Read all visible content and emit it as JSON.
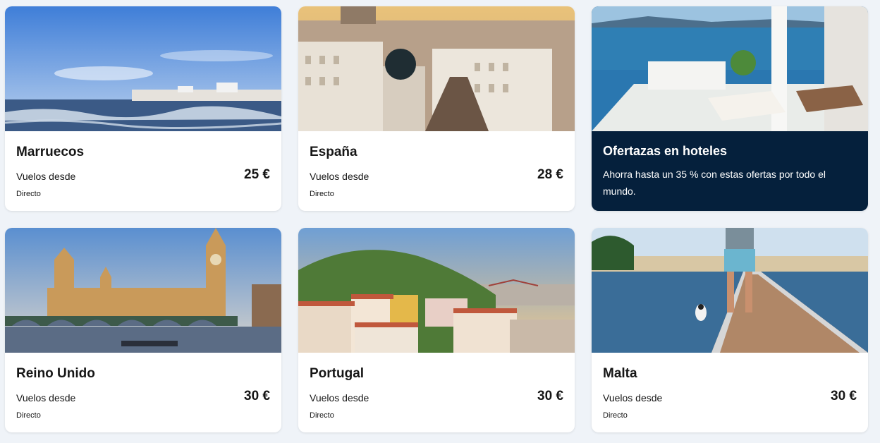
{
  "cards": [
    {
      "title": "Marruecos",
      "label": "Vuelos desde",
      "price": "25 €",
      "sub": "Directo"
    },
    {
      "title": "España",
      "label": "Vuelos desde",
      "price": "28 €",
      "sub": "Directo"
    },
    {
      "title": "Ofertazas en hoteles",
      "description": "Ahorra hasta un 35 % con estas ofertas por todo el mundo.",
      "background": "#05203c"
    },
    {
      "title": "Reino Unido",
      "label": "Vuelos desde",
      "price": "30 €",
      "sub": "Directo"
    },
    {
      "title": "Portugal",
      "label": "Vuelos desde",
      "price": "30 €",
      "sub": "Directo"
    },
    {
      "title": "Malta",
      "label": "Vuelos desde",
      "price": "30 €",
      "sub": "Directo"
    }
  ]
}
